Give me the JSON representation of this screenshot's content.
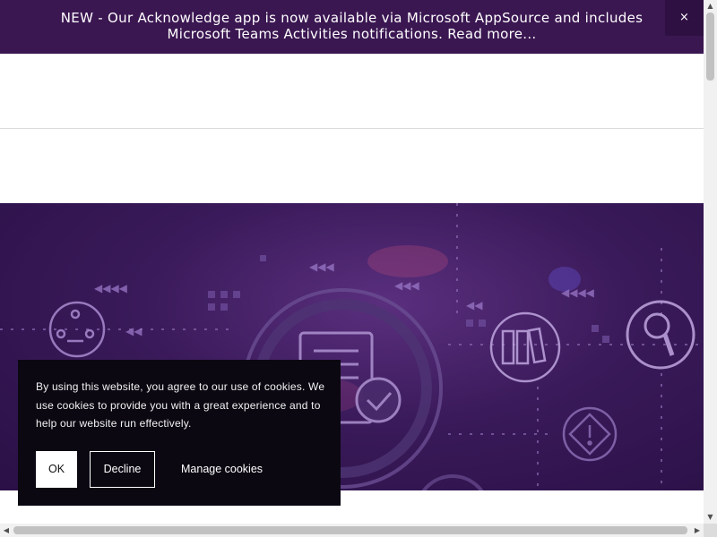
{
  "banner": {
    "text": "NEW - Our Acknowledge app is now available via Microsoft AppSource and includes Microsoft Teams Activities notifications. Read more...",
    "close_label": "×"
  },
  "hero": {
    "icons": [
      "people-exchange-icon",
      "document-check-icon",
      "binders-icon",
      "magnifier-icon",
      "warning-diamond-icon"
    ]
  },
  "cookie": {
    "message": "By using this website, you agree to our use of cookies. We use cookies to provide you with a great experience and to help our website run effectively.",
    "ok_label": "OK",
    "decline_label": "Decline",
    "manage_label": "Manage cookies"
  },
  "scrollbars": {
    "up": "▲",
    "down": "▼",
    "left": "◀",
    "right": "▶"
  },
  "colors": {
    "banner_bg": "#3b1752",
    "hero_bg": "#2f1248",
    "cookie_bg": "#0b0812"
  }
}
